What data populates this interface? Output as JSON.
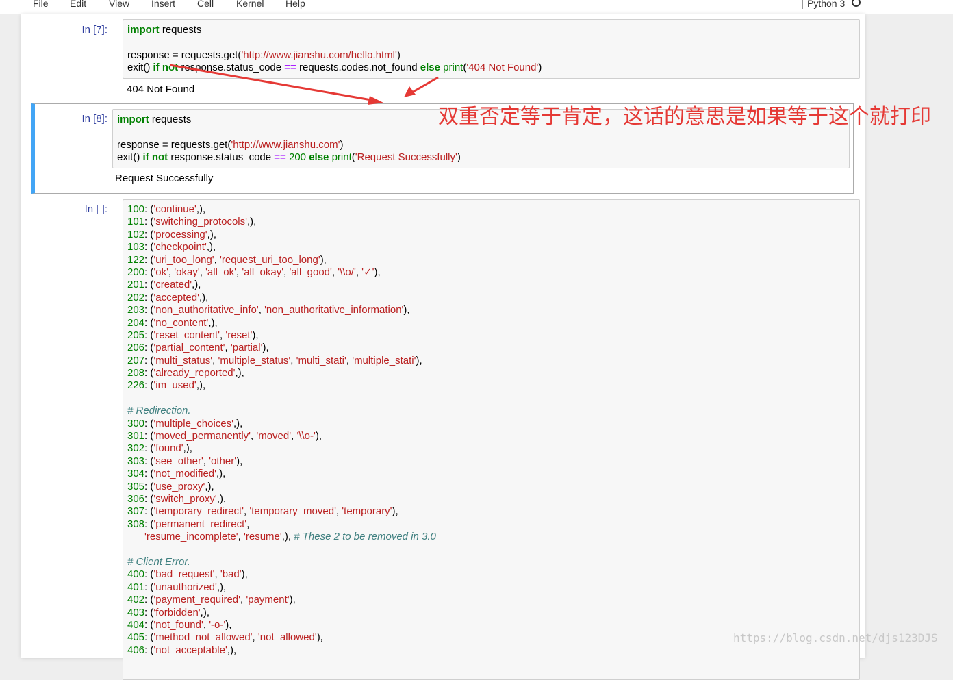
{
  "menubar": {
    "items": [
      "File",
      "Edit",
      "View",
      "Insert",
      "Cell",
      "Kernel",
      "Help"
    ],
    "kernel": "Python 3"
  },
  "cell7": {
    "prompt": "In [7]:",
    "lines": [
      [
        {
          "t": "import",
          "c": "kw"
        },
        {
          "t": " requests"
        }
      ],
      [],
      [
        {
          "t": "response = requests.get("
        },
        {
          "t": "'http://www.jianshu.com/hello.html'",
          "c": "str"
        },
        {
          "t": ")"
        }
      ],
      [
        {
          "t": "exit() "
        },
        {
          "t": "if",
          "c": "kw"
        },
        {
          "t": " "
        },
        {
          "t": "not",
          "c": "kw"
        },
        {
          "t": " response.status_code "
        },
        {
          "t": "==",
          "c": "op"
        },
        {
          "t": " requests.codes.not_found "
        },
        {
          "t": "else",
          "c": "kw"
        },
        {
          "t": " "
        },
        {
          "t": "print",
          "c": "bi"
        },
        {
          "t": "("
        },
        {
          "t": "'404 Not Found'",
          "c": "str"
        },
        {
          "t": ")"
        }
      ]
    ],
    "output": "404 Not Found"
  },
  "cell8": {
    "prompt": "In [8]:",
    "lines": [
      [
        {
          "t": "import",
          "c": "kw"
        },
        {
          "t": " requests"
        }
      ],
      [],
      [
        {
          "t": "response = requests.get("
        },
        {
          "t": "'http://www.jianshu.com'",
          "c": "str"
        },
        {
          "t": ")"
        }
      ],
      [
        {
          "t": "exit() "
        },
        {
          "t": "if",
          "c": "kw"
        },
        {
          "t": " "
        },
        {
          "t": "not",
          "c": "kw"
        },
        {
          "t": " response.status_code "
        },
        {
          "t": "==",
          "c": "op"
        },
        {
          "t": " "
        },
        {
          "t": "200",
          "c": "num"
        },
        {
          "t": " "
        },
        {
          "t": "else",
          "c": "kw"
        },
        {
          "t": " "
        },
        {
          "t": "print",
          "c": "bi"
        },
        {
          "t": "("
        },
        {
          "t": "'Request Successfully'",
          "c": "str"
        },
        {
          "t": ")"
        }
      ]
    ],
    "output": "Request Successfully"
  },
  "cell9": {
    "prompt": "In [ ]:",
    "lines": [
      [
        {
          "t": "100",
          "c": "num"
        },
        {
          "t": ": ("
        },
        {
          "t": "'continue'",
          "c": "str"
        },
        {
          "t": ",),"
        }
      ],
      [
        {
          "t": "101",
          "c": "num"
        },
        {
          "t": ": ("
        },
        {
          "t": "'switching_protocols'",
          "c": "str"
        },
        {
          "t": ",),"
        }
      ],
      [
        {
          "t": "102",
          "c": "num"
        },
        {
          "t": ": ("
        },
        {
          "t": "'processing'",
          "c": "str"
        },
        {
          "t": ",),"
        }
      ],
      [
        {
          "t": "103",
          "c": "num"
        },
        {
          "t": ": ("
        },
        {
          "t": "'checkpoint'",
          "c": "str"
        },
        {
          "t": ",),"
        }
      ],
      [
        {
          "t": "122",
          "c": "num"
        },
        {
          "t": ": ("
        },
        {
          "t": "'uri_too_long'",
          "c": "str"
        },
        {
          "t": ", "
        },
        {
          "t": "'request_uri_too_long'",
          "c": "str"
        },
        {
          "t": "),"
        }
      ],
      [
        {
          "t": "200",
          "c": "num"
        },
        {
          "t": ": ("
        },
        {
          "t": "'ok'",
          "c": "str"
        },
        {
          "t": ", "
        },
        {
          "t": "'okay'",
          "c": "str"
        },
        {
          "t": ", "
        },
        {
          "t": "'all_ok'",
          "c": "str"
        },
        {
          "t": ", "
        },
        {
          "t": "'all_okay'",
          "c": "str"
        },
        {
          "t": ", "
        },
        {
          "t": "'all_good'",
          "c": "str"
        },
        {
          "t": ", "
        },
        {
          "t": "'\\\\o/'",
          "c": "str"
        },
        {
          "t": ", "
        },
        {
          "t": "'✓'",
          "c": "str"
        },
        {
          "t": "),"
        }
      ],
      [
        {
          "t": "201",
          "c": "num"
        },
        {
          "t": ": ("
        },
        {
          "t": "'created'",
          "c": "str"
        },
        {
          "t": ",),"
        }
      ],
      [
        {
          "t": "202",
          "c": "num"
        },
        {
          "t": ": ("
        },
        {
          "t": "'accepted'",
          "c": "str"
        },
        {
          "t": ",),"
        }
      ],
      [
        {
          "t": "203",
          "c": "num"
        },
        {
          "t": ": ("
        },
        {
          "t": "'non_authoritative_info'",
          "c": "str"
        },
        {
          "t": ", "
        },
        {
          "t": "'non_authoritative_information'",
          "c": "str"
        },
        {
          "t": "),"
        }
      ],
      [
        {
          "t": "204",
          "c": "num"
        },
        {
          "t": ": ("
        },
        {
          "t": "'no_content'",
          "c": "str"
        },
        {
          "t": ",),"
        }
      ],
      [
        {
          "t": "205",
          "c": "num"
        },
        {
          "t": ": ("
        },
        {
          "t": "'reset_content'",
          "c": "str"
        },
        {
          "t": ", "
        },
        {
          "t": "'reset'",
          "c": "str"
        },
        {
          "t": "),"
        }
      ],
      [
        {
          "t": "206",
          "c": "num"
        },
        {
          "t": ": ("
        },
        {
          "t": "'partial_content'",
          "c": "str"
        },
        {
          "t": ", "
        },
        {
          "t": "'partial'",
          "c": "str"
        },
        {
          "t": "),"
        }
      ],
      [
        {
          "t": "207",
          "c": "num"
        },
        {
          "t": ": ("
        },
        {
          "t": "'multi_status'",
          "c": "str"
        },
        {
          "t": ", "
        },
        {
          "t": "'multiple_status'",
          "c": "str"
        },
        {
          "t": ", "
        },
        {
          "t": "'multi_stati'",
          "c": "str"
        },
        {
          "t": ", "
        },
        {
          "t": "'multiple_stati'",
          "c": "str"
        },
        {
          "t": "),"
        }
      ],
      [
        {
          "t": "208",
          "c": "num"
        },
        {
          "t": ": ("
        },
        {
          "t": "'already_reported'",
          "c": "str"
        },
        {
          "t": ",),"
        }
      ],
      [
        {
          "t": "226",
          "c": "num"
        },
        {
          "t": ": ("
        },
        {
          "t": "'im_used'",
          "c": "str"
        },
        {
          "t": ",),"
        }
      ],
      [],
      [
        {
          "t": "# Redirection.",
          "c": "cm"
        }
      ],
      [
        {
          "t": "300",
          "c": "num"
        },
        {
          "t": ": ("
        },
        {
          "t": "'multiple_choices'",
          "c": "str"
        },
        {
          "t": ",),"
        }
      ],
      [
        {
          "t": "301",
          "c": "num"
        },
        {
          "t": ": ("
        },
        {
          "t": "'moved_permanently'",
          "c": "str"
        },
        {
          "t": ", "
        },
        {
          "t": "'moved'",
          "c": "str"
        },
        {
          "t": ", "
        },
        {
          "t": "'\\\\o-'",
          "c": "str"
        },
        {
          "t": "),"
        }
      ],
      [
        {
          "t": "302",
          "c": "num"
        },
        {
          "t": ": ("
        },
        {
          "t": "'found'",
          "c": "str"
        },
        {
          "t": ",),"
        }
      ],
      [
        {
          "t": "303",
          "c": "num"
        },
        {
          "t": ": ("
        },
        {
          "t": "'see_other'",
          "c": "str"
        },
        {
          "t": ", "
        },
        {
          "t": "'other'",
          "c": "str"
        },
        {
          "t": "),"
        }
      ],
      [
        {
          "t": "304",
          "c": "num"
        },
        {
          "t": ": ("
        },
        {
          "t": "'not_modified'",
          "c": "str"
        },
        {
          "t": ",),"
        }
      ],
      [
        {
          "t": "305",
          "c": "num"
        },
        {
          "t": ": ("
        },
        {
          "t": "'use_proxy'",
          "c": "str"
        },
        {
          "t": ",),"
        }
      ],
      [
        {
          "t": "306",
          "c": "num"
        },
        {
          "t": ": ("
        },
        {
          "t": "'switch_proxy'",
          "c": "str"
        },
        {
          "t": ",),"
        }
      ],
      [
        {
          "t": "307",
          "c": "num"
        },
        {
          "t": ": ("
        },
        {
          "t": "'temporary_redirect'",
          "c": "str"
        },
        {
          "t": ", "
        },
        {
          "t": "'temporary_moved'",
          "c": "str"
        },
        {
          "t": ", "
        },
        {
          "t": "'temporary'",
          "c": "str"
        },
        {
          "t": "),"
        }
      ],
      [
        {
          "t": "308",
          "c": "num"
        },
        {
          "t": ": ("
        },
        {
          "t": "'permanent_redirect'",
          "c": "str"
        },
        {
          "t": ","
        }
      ],
      [
        {
          "t": "      "
        },
        {
          "t": "'resume_incomplete'",
          "c": "str"
        },
        {
          "t": ", "
        },
        {
          "t": "'resume'",
          "c": "str"
        },
        {
          "t": ",), "
        },
        {
          "t": "# These 2 to be removed in 3.0",
          "c": "cm"
        }
      ],
      [],
      [
        {
          "t": "# Client Error.",
          "c": "cm"
        }
      ],
      [
        {
          "t": "400",
          "c": "num"
        },
        {
          "t": ": ("
        },
        {
          "t": "'bad_request'",
          "c": "str"
        },
        {
          "t": ", "
        },
        {
          "t": "'bad'",
          "c": "str"
        },
        {
          "t": "),"
        }
      ],
      [
        {
          "t": "401",
          "c": "num"
        },
        {
          "t": ": ("
        },
        {
          "t": "'unauthorized'",
          "c": "str"
        },
        {
          "t": ",),"
        }
      ],
      [
        {
          "t": "402",
          "c": "num"
        },
        {
          "t": ": ("
        },
        {
          "t": "'payment_required'",
          "c": "str"
        },
        {
          "t": ", "
        },
        {
          "t": "'payment'",
          "c": "str"
        },
        {
          "t": "),"
        }
      ],
      [
        {
          "t": "403",
          "c": "num"
        },
        {
          "t": ": ("
        },
        {
          "t": "'forbidden'",
          "c": "str"
        },
        {
          "t": ",),"
        }
      ],
      [
        {
          "t": "404",
          "c": "num"
        },
        {
          "t": ": ("
        },
        {
          "t": "'not_found'",
          "c": "str"
        },
        {
          "t": ", "
        },
        {
          "t": "'-o-'",
          "c": "str"
        },
        {
          "t": "),"
        }
      ],
      [
        {
          "t": "405",
          "c": "num"
        },
        {
          "t": ": ("
        },
        {
          "t": "'method_not_allowed'",
          "c": "str"
        },
        {
          "t": ", "
        },
        {
          "t": "'not_allowed'",
          "c": "str"
        },
        {
          "t": "),"
        }
      ],
      [
        {
          "t": "406",
          "c": "num"
        },
        {
          "t": ": ("
        },
        {
          "t": "'not_acceptable'",
          "c": "str"
        },
        {
          "t": ",),"
        }
      ]
    ]
  },
  "annotation": "双重否定等于肯定，这话的意思是如果等于这个就打印",
  "watermark": "https://blog.csdn.net/djs123DJS",
  "colors": {
    "keyword": "#008000",
    "string": "#ba2121",
    "comment": "#408080",
    "operator": "#aa22ff",
    "prompt": "#303f9f",
    "selected_border": "#42a5f5",
    "annotation": "#e53935"
  }
}
